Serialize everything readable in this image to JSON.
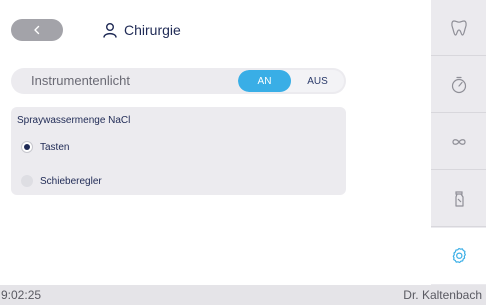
{
  "header": {
    "back_icon": "chevron-left-icon",
    "user_icon": "user-icon",
    "title": "Chirurgie"
  },
  "light": {
    "label": "Instrumentenlicht",
    "on_label": "AN",
    "off_label": "AUS",
    "selected": "AN",
    "accent": "#39aee6"
  },
  "spray": {
    "title": "Spraywassermenge NaCl",
    "options": [
      {
        "label": "Tasten",
        "selected": true
      },
      {
        "label": "Schieberegler",
        "selected": false
      }
    ]
  },
  "sidebar": {
    "items": [
      {
        "icon": "tooth-icon"
      },
      {
        "icon": "timer-icon"
      },
      {
        "icon": "infinity-icon"
      },
      {
        "icon": "spray-bottle-icon"
      },
      {
        "icon": "settings-gear-icon",
        "active": true
      }
    ]
  },
  "status": {
    "time": "9:02:25",
    "user": "Dr. Kaltenbach"
  }
}
